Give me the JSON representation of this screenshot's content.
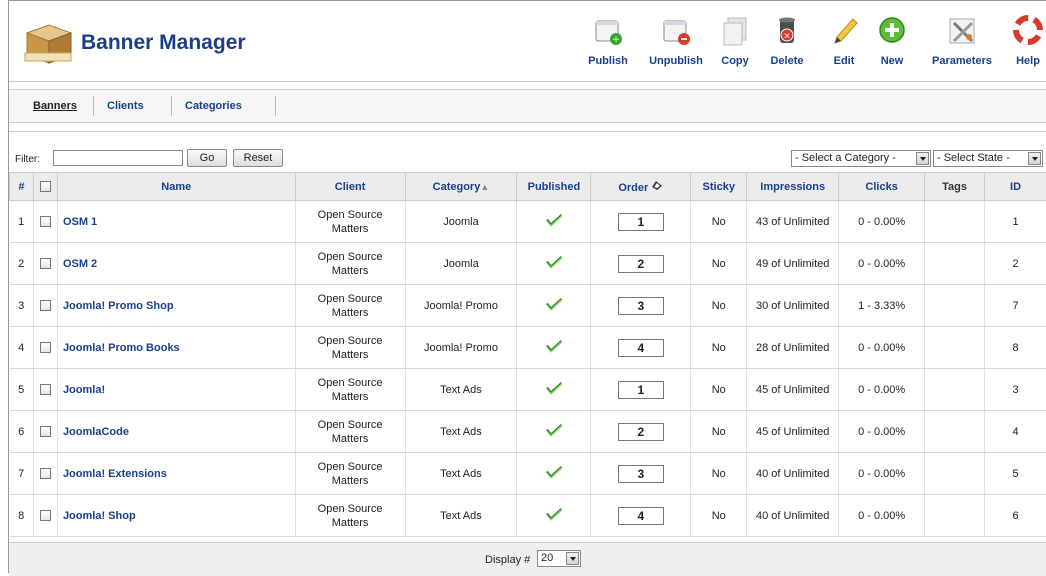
{
  "app": {
    "title": "Banner Manager"
  },
  "toolbar": [
    {
      "label": "Publish",
      "icon": "publish-icon"
    },
    {
      "label": "Unpublish",
      "icon": "unpublish-icon"
    },
    {
      "label": "Copy",
      "icon": "copy-icon"
    },
    {
      "label": "Delete",
      "icon": "delete-icon"
    },
    {
      "label": "Edit",
      "icon": "edit-icon"
    },
    {
      "label": "New",
      "icon": "new-icon"
    },
    {
      "label": "Parameters",
      "icon": "parameters-icon"
    },
    {
      "label": "Help",
      "icon": "help-icon"
    }
  ],
  "submenu": [
    {
      "label": "Banners",
      "active": true
    },
    {
      "label": "Clients",
      "active": false
    },
    {
      "label": "Categories",
      "active": false
    }
  ],
  "filter": {
    "label": "Filter:",
    "value": "",
    "go_label": "Go",
    "reset_label": "Reset",
    "category_select": "- Select a Category -",
    "state_select": "- Select State -"
  },
  "table": {
    "headers": {
      "num": "#",
      "name": "Name",
      "client": "Client",
      "category": "Category",
      "published": "Published",
      "order": "Order",
      "sticky": "Sticky",
      "impressions": "Impressions",
      "clicks": "Clicks",
      "tags": "Tags",
      "id": "ID"
    },
    "rows": [
      {
        "num": "1",
        "name": "OSM 1",
        "client_line1": "Open Source",
        "client_line2": "Matters",
        "category": "Joomla",
        "order": "1",
        "sticky": "No",
        "impressions": "43 of Unlimited",
        "clicks": "0 - 0.00%",
        "tags": "",
        "id": "1"
      },
      {
        "num": "2",
        "name": "OSM 2",
        "client_line1": "Open Source",
        "client_line2": "Matters",
        "category": "Joomla",
        "order": "2",
        "sticky": "No",
        "impressions": "49 of Unlimited",
        "clicks": "0 - 0.00%",
        "tags": "",
        "id": "2"
      },
      {
        "num": "3",
        "name": "Joomla! Promo Shop",
        "client_line1": "Open Source",
        "client_line2": "Matters",
        "category": "Joomla! Promo",
        "order": "3",
        "sticky": "No",
        "impressions": "30 of Unlimited",
        "clicks": "1 - 3.33%",
        "tags": "",
        "id": "7"
      },
      {
        "num": "4",
        "name": "Joomla! Promo Books",
        "client_line1": "Open Source",
        "client_line2": "Matters",
        "category": "Joomla! Promo",
        "order": "4",
        "sticky": "No",
        "impressions": "28 of Unlimited",
        "clicks": "0 - 0.00%",
        "tags": "",
        "id": "8"
      },
      {
        "num": "5",
        "name": "Joomla!",
        "client_line1": "Open Source",
        "client_line2": "Matters",
        "category": "Text Ads",
        "order": "1",
        "sticky": "No",
        "impressions": "45 of Unlimited",
        "clicks": "0 - 0.00%",
        "tags": "",
        "id": "3"
      },
      {
        "num": "6",
        "name": "JoomlaCode",
        "client_line1": "Open Source",
        "client_line2": "Matters",
        "category": "Text Ads",
        "order": "2",
        "sticky": "No",
        "impressions": "45 of Unlimited",
        "clicks": "0 - 0.00%",
        "tags": "",
        "id": "4"
      },
      {
        "num": "7",
        "name": "Joomla! Extensions",
        "client_line1": "Open Source",
        "client_line2": "Matters",
        "category": "Text Ads",
        "order": "3",
        "sticky": "No",
        "impressions": "40 of Unlimited",
        "clicks": "0 - 0.00%",
        "tags": "",
        "id": "5"
      },
      {
        "num": "8",
        "name": "Joomla! Shop",
        "client_line1": "Open Source",
        "client_line2": "Matters",
        "category": "Text Ads",
        "order": "4",
        "sticky": "No",
        "impressions": "40 of Unlimited",
        "clicks": "0 - 0.00%",
        "tags": "",
        "id": "6"
      }
    ]
  },
  "footer": {
    "display_label": "Display #",
    "display_value": "20"
  },
  "colors": {
    "link": "#1a3f8a",
    "header_bg": "#ececec",
    "check": "#2e8b1e"
  }
}
